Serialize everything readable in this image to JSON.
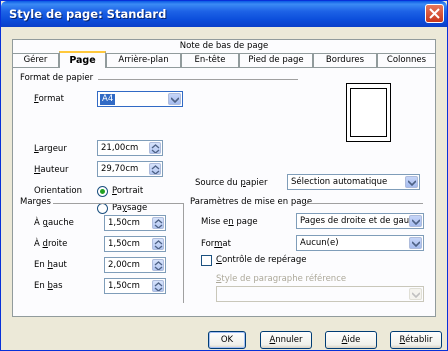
{
  "window": {
    "title": "Style de page: Standard"
  },
  "tabs_top": [
    {
      "label": "Note de bas de page"
    }
  ],
  "tabs": [
    {
      "label": "Gérer"
    },
    {
      "label": "Page"
    },
    {
      "label": "Arrière-plan"
    },
    {
      "label": "En-tête"
    },
    {
      "label": "Pied de page"
    },
    {
      "label": "Bordures"
    },
    {
      "label": "Colonnes"
    }
  ],
  "format": {
    "section_title": "Format de papier",
    "format_label": "Format",
    "format_value": "A4",
    "width_label": "Largeur",
    "width_value": "21,00cm",
    "height_label": "Hauteur",
    "height_value": "29,70cm",
    "orientation_label": "Orientation",
    "portrait_label": "Portrait",
    "landscape_label": "Paysage",
    "orientation_selected": "Portrait",
    "source_label": "Source du papier",
    "source_value": "Sélection automatique"
  },
  "margins": {
    "section_title": "Marges",
    "left_label": "À gauche",
    "left_value": "1,50cm",
    "right_label": "À droite",
    "right_value": "1,50cm",
    "top_label": "En haut",
    "top_value": "2,00cm",
    "bottom_label": "En bas",
    "bottom_value": "1,50cm"
  },
  "layout": {
    "section_title": "Paramètres de mise en page",
    "layout_label": "Mise en page",
    "layout_value": "Pages de droite et de gauche",
    "format_label": "Format",
    "format_value": "Aucun(e)",
    "register_label": "Contrôle de repérage",
    "register_checked": false,
    "ref_style_label": "Style de paragraphe référence",
    "ref_style_value": ""
  },
  "buttons": {
    "ok": "OK",
    "cancel": "Annuler",
    "help": "Aide",
    "reset": "Rétablir"
  },
  "colors": {
    "title_bar": "#0a4fdc",
    "dialog_bg": "#ece9d8",
    "active_tab_accent": "#ffc83c",
    "radio_dot": "#21a121"
  }
}
